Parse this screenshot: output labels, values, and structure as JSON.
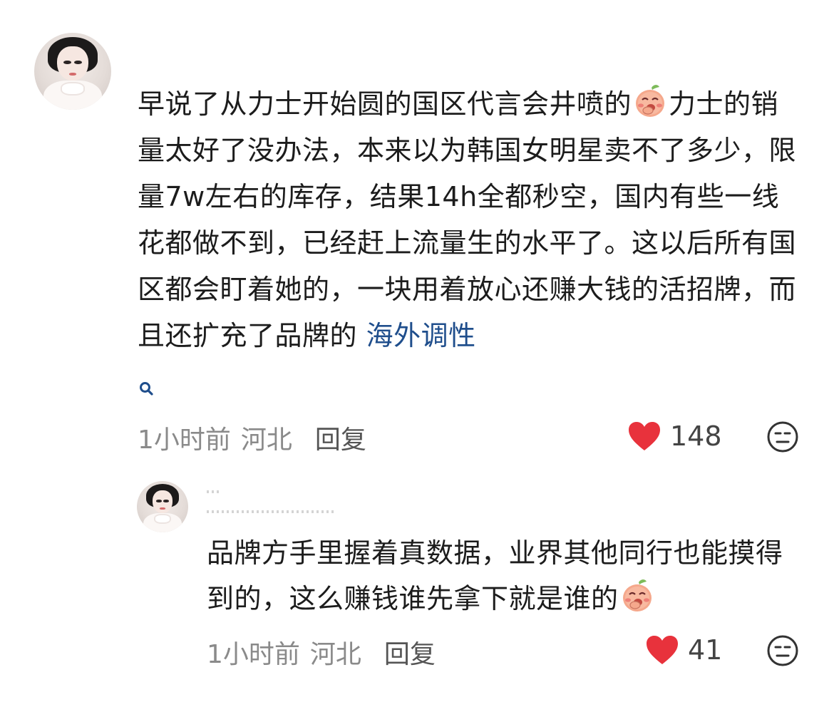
{
  "comment": {
    "text_before_link": "早说了从力士开始圆的国区代言会井喷的",
    "text_after_emoji": "力士的销量太好了没办法，本来以为韩国女明星卖不了多少，限量7w左右的库存，结果14h全都秒空，国内有些一线花都做不到，已经赶上流量生的水平了。这以后所有国区都会盯着她的，一块用着放心还赚大钱的活招牌，而且还扩充了品牌的",
    "link_text": "海外调性",
    "time": "1小时前",
    "region": "河北",
    "reply_label": "回复",
    "like_count": "148",
    "emoji_icon": "peach-laugh-emoji",
    "search_icon": "search-icon"
  },
  "reply": {
    "text_before_emoji": "品牌方手里握着真数据，业界其他同行也能摸得到的，这么赚钱谁先拿下就是谁的",
    "time": "1小时前",
    "region": "河北",
    "reply_label": "回复",
    "like_count": "41",
    "emoji_icon": "peach-laugh-emoji"
  },
  "colors": {
    "like_heart": "#e8323c",
    "link": "#1f4e8c",
    "meta_text": "#8a8a8a"
  }
}
